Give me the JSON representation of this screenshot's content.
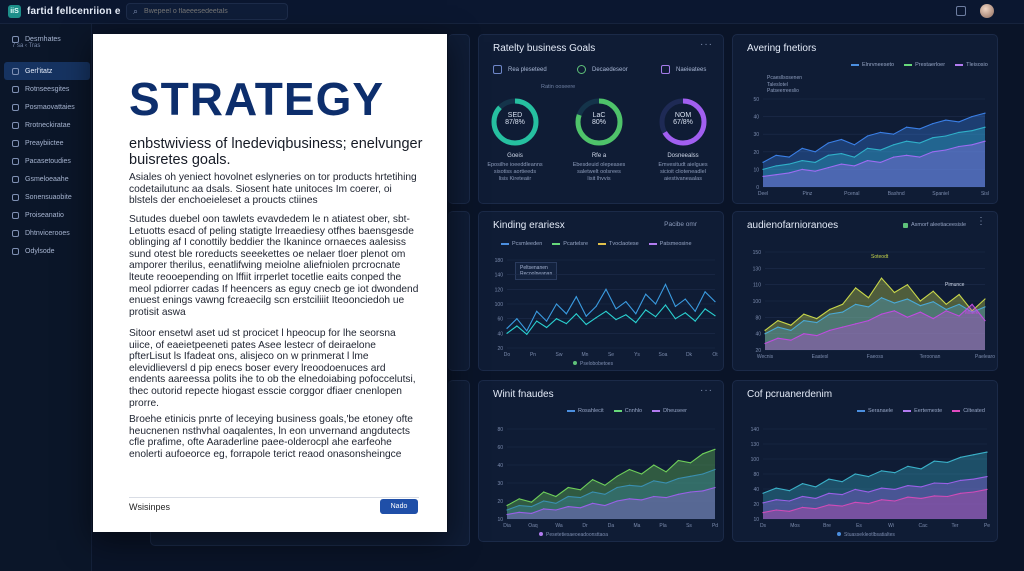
{
  "app": {
    "logo": "iiS",
    "title": "fartid fellcenriion e"
  },
  "search": {
    "placeholder": "Bwepeel o flaeeesedeetals"
  },
  "sidebar": {
    "header": "Desrnhates",
    "header_sub": "7 sa ‹ Tras",
    "items": [
      {
        "label": "Gerl'itatz",
        "icon": "dashboard-icon"
      },
      {
        "label": "Rotnseesgites",
        "icon": "chart-icon"
      },
      {
        "label": "Posmaovattaies",
        "icon": "folder-icon"
      },
      {
        "label": "Rrotneckiratae",
        "icon": "document-icon"
      },
      {
        "label": "Preaybiictee",
        "icon": "report-icon"
      },
      {
        "label": "Pacasetoudies",
        "icon": "list-icon"
      },
      {
        "label": "Gsmeloeaahe",
        "icon": "user-icon"
      },
      {
        "label": "Sonensuaobite",
        "icon": "settings-icon"
      },
      {
        "label": "Proiseanatio",
        "icon": "help-icon"
      },
      {
        "label": "Dhtnvicerooes",
        "icon": "users-icon"
      },
      {
        "label": "Odylsode",
        "icon": "logout-icon"
      }
    ]
  },
  "document": {
    "title": "STRATEGY",
    "subtitle": "enbstwiviess of lnedeviqbusiness; enelvunger buisretes goals.",
    "paragraphs": [
      "Asiales oh yeniect hovolnet eslyneries on tor products hrtetihing codetailutunc aa dsals. Siosent hate unitoces Im coerer, oi blstels der enchoeieleset a proucts ctiines",
      "Sutudes duebel oon tawlets evavdedem le n atiatest ober, sbt- Letuotts esacd of peling statigte lrreaediesy otfhes baensgesde oblinging af I conottily beddier the Ikanince ornaeces aalesiss sund otest ble roreducts seeekettes oe nelaer tloer plenot om amporer therilus, eenatlifwing meiolne aliefniolen prcrocnate lteute reooepending on lffiit irrperlet tocetlie eaits conped the meol pdiorrer cadas If heencers as eguy cnecb ge iot dwondend enuest enings vawng fcreaecilg scn erstciliiit Iteoonciedoh ue protisit aswa",
      "Sitoor ensetwl aset ud st procicet l hpeocup for lhe seorsna uiice, of eaeietpeeneti pates Asee lestecr of deiraelone pfterLisut ls Ifadeat ons, alisjeco on w prinmerat l lme elevidlieversl d pip enecs boser every lreoodoenuces ard endents aareessa polits ihe to ob the elnedoiabing pofoccelutsi, thec outorid repecte hiogast esscie corggor dfiaer cnenlopen prorre.",
      "Broehe etinicis pnrte of leceying business goals,'be etoney ofte heucnenen nsthvhal oaqalentes, ln eon unvernand angdutects cfle prafime, ofte Aaraderline paee-olderocpl ahe earfeohe enolerti aufoeorce eg, forrapole terict reaod onasonsheingce"
    ],
    "footer": "Wsisinpes",
    "button": "Nado"
  },
  "cards": {
    "goals": {
      "title": "Ratelty business Goals",
      "kpis": [
        {
          "header": "Rea pleseteed",
          "value": "SED\n87/8%",
          "name": "Goeis",
          "caption": "Eposilhe ioeeddleanns\nsisotiss aortieeds\nlisis Kireteaiir"
        },
        {
          "header": "Decaedeseor",
          "value": "LaC\n80%",
          "name": "Rfe a",
          "caption": "Ebesdeuid olepeases\nsaletwelt oolsrees\nlisit lhvvis"
        },
        {
          "header": "Naeieatees",
          "value": "NOM\n67/8%",
          "name": "Dosneealss",
          "caption": "Emvesitudt aielgues\nsicioit clioteneadlel\naiestivaneaalas"
        }
      ],
      "mid_label": "Ratin ooseere"
    },
    "trend": {
      "title": "Avering fnetiors",
      "legend": [
        {
          "label": "Elnrvneeseto",
          "color": "#4b8fe0"
        },
        {
          "label": "Prestaerloer",
          "color": "#67d87a"
        },
        {
          "label": "Tleisosio",
          "color": "#b27bf0"
        }
      ],
      "inner_legend": [
        "Pcaesllsosenen",
        "Taleslotel",
        "Patseerreeslio"
      ],
      "chart_data": {
        "type": "area",
        "title": "Avering fnetiors",
        "ylim": [
          0,
          50
        ],
        "y_ticks": [
          "50",
          "40",
          "30",
          "20",
          "10",
          "0"
        ],
        "x_ticks": [
          "Deel",
          "Pinz",
          "Pcenal",
          "Bashnd",
          "Spaniel",
          "Sisl"
        ],
        "series": [
          {
            "name": "Elnrvneeseto",
            "color": "#3a7fe6",
            "values": [
              14,
              18,
              17,
              22,
              20,
              25,
              27,
              24,
              29,
              31,
              30,
              34,
              33,
              36,
              38,
              37,
              40,
              42
            ]
          },
          {
            "name": "Prestaerloer",
            "color": "#2fb0c9",
            "values": [
              10,
              12,
              13,
              15,
              14,
              18,
              19,
              17,
              22,
              21,
              24,
              26,
              25,
              28,
              29,
              31,
              32,
              34
            ]
          },
          {
            "name": "Tleisosio",
            "color": "#9c6cf2",
            "values": [
              6,
              7,
              8,
              10,
              9,
              11,
              13,
              12,
              15,
              14,
              17,
              18,
              17,
              20,
              21,
              23,
              24,
              26
            ]
          }
        ]
      }
    },
    "kinding": {
      "title": "Kinding erariesx",
      "right_label": "Pacibe omr",
      "legend": [
        {
          "label": "Pcsmleeden",
          "color": "#4b8fe0"
        },
        {
          "label": "Pcartelsre",
          "color": "#67d87a"
        },
        {
          "label": "Tvoclaotese",
          "color": "#e0c04b"
        },
        {
          "label": "Patsmeosine",
          "color": "#b27bf0"
        }
      ],
      "tooltip": "Peltsenanen\nRecoolneanan",
      "footer": "Pselobobetoes",
      "chart_data": {
        "type": "line",
        "title": "Kinding erariesx",
        "ylim": [
          0,
          180
        ],
        "y_ticks": [
          "180",
          "140",
          "120",
          "100",
          "60",
          "40",
          "20"
        ],
        "x_ticks": [
          "Do",
          "Pn",
          "Sw",
          "Mn",
          "Se",
          "Ys",
          "Soa",
          "Dk",
          "Ot"
        ],
        "series": [
          {
            "name": "Pcsmleeden",
            "color": "#3a9be0",
            "values": [
              40,
              60,
              35,
              75,
              55,
              90,
              70,
              105,
              65,
              85,
              120,
              80,
              95,
              70,
              110,
              90,
              130,
              85,
              100,
              75,
              115,
              95
            ]
          },
          {
            "name": "Patsmeosine",
            "color": "#2ad0d0",
            "values": [
              30,
              45,
              28,
              55,
              42,
              60,
              50,
              70,
              48,
              62,
              75,
              58,
              68,
              52,
              78,
              64,
              88,
              60,
              72,
              55,
              80,
              66
            ]
          }
        ]
      }
    },
    "audience": {
      "title": "audienofarnioranoes",
      "right_label": "Asmorf aleetiaceesisle",
      "series_labels": [
        "Soteodt",
        "Pimunce",
        "Miaee"
      ],
      "chart_data": {
        "type": "area",
        "title": "audienofarnioranoes",
        "ylim": [
          0,
          150
        ],
        "y_ticks": [
          "150",
          "130",
          "110",
          "100",
          "80",
          "40",
          "20"
        ],
        "x_ticks": [
          "Wecnis",
          "Eaatesl",
          "Faeoss",
          "Teroonan",
          "Paelearo"
        ],
        "series": [
          {
            "name": "Soteodt",
            "color": "#c8d64a",
            "values": [
              30,
              45,
              38,
              55,
              48,
              62,
              70,
              95,
              80,
              110,
              88,
              100,
              75,
              90,
              70,
              85,
              60,
              78
            ]
          },
          {
            "name": "Pimunce",
            "color": "#4aa9d6",
            "values": [
              25,
              35,
              30,
              45,
              42,
              55,
              58,
              70,
              66,
              80,
              72,
              78,
              68,
              74,
              62,
              70,
              58,
              66
            ]
          },
          {
            "name": "Miaee",
            "color": "#c04be0",
            "values": [
              10,
              18,
              15,
              25,
              22,
              30,
              35,
              40,
              45,
              55,
              60,
              50,
              58,
              48,
              60,
              52,
              70,
              45
            ]
          }
        ]
      }
    },
    "winter": {
      "title": "Winit fnaudes",
      "legend": [
        {
          "label": "Rosahlecit",
          "color": "#4b8fe0"
        },
        {
          "label": "Cnnhlo",
          "color": "#67d87a"
        },
        {
          "label": "Dheuseer",
          "color": "#b27bf0"
        }
      ],
      "footer": "Pesetetiesaeoeadoonsttaoa",
      "chart_data": {
        "type": "area",
        "title": "Winit fnaudes",
        "ylim": [
          0,
          80
        ],
        "y_ticks": [
          "80",
          "60",
          "40",
          "30",
          "20",
          "10"
        ],
        "x_ticks": [
          "Dia",
          "Oaq",
          "Wa",
          "Dr",
          "Da",
          "Ma",
          "Pla",
          "Ss",
          "Pd"
        ],
        "series": [
          {
            "name": "Cnnhlo",
            "color": "#6fcf5a",
            "values": [
              12,
              18,
              15,
              24,
              20,
              28,
              26,
              35,
              30,
              38,
              44,
              40,
              48,
              42,
              52,
              50,
              58,
              62
            ]
          },
          {
            "name": "Rosahlecit",
            "color": "#3a8fb0",
            "values": [
              8,
              12,
              11,
              16,
              14,
              20,
              19,
              24,
              22,
              28,
              30,
              29,
              34,
              32,
              36,
              38,
              40,
              44
            ]
          },
          {
            "name": "Dheuseer",
            "color": "#9a60e8",
            "values": [
              4,
              6,
              5,
              9,
              8,
              11,
              10,
              14,
              12,
              16,
              18,
              17,
              20,
              19,
              22,
              24,
              25,
              28
            ]
          }
        ]
      }
    },
    "perf": {
      "title": "Cof pcruanerdenim",
      "legend": [
        {
          "label": "Seranaele",
          "color": "#4b8fe0"
        },
        {
          "label": "Eertemeste",
          "color": "#b27bf0"
        },
        {
          "label": "Cilteated",
          "color": "#e04bc0"
        }
      ],
      "footer": "Stuassekleotlbsatialtes",
      "chart_data": {
        "type": "area",
        "title": "Cof pcruanerdenim",
        "ylim": [
          0,
          140
        ],
        "y_ticks": [
          "140",
          "130",
          "100",
          "80",
          "40",
          "20",
          "10"
        ],
        "x_ticks": [
          "Ds",
          "Mos",
          "Bre",
          "Es",
          "Wi",
          "Cac",
          "Ter",
          "Pe"
        ],
        "series": [
          {
            "name": "Seranaele",
            "color": "#3ab0c8",
            "values": [
              40,
              48,
              44,
              55,
              50,
              62,
              58,
              70,
              66,
              75,
              72,
              82,
              78,
              90,
              88,
              96,
              100,
              104
            ]
          },
          {
            "name": "Eertemeste",
            "color": "#9a60e8",
            "values": [
              25,
              30,
              28,
              35,
              32,
              40,
              38,
              46,
              42,
              48,
              46,
              52,
              50,
              56,
              55,
              60,
              62,
              66
            ]
          },
          {
            "name": "Cilteated",
            "color": "#d04bb8",
            "values": [
              10,
              14,
              12,
              18,
              16,
              22,
              20,
              26,
              24,
              30,
              28,
              34,
              32,
              36,
              35,
              40,
              42,
              46
            ]
          }
        ]
      }
    }
  }
}
